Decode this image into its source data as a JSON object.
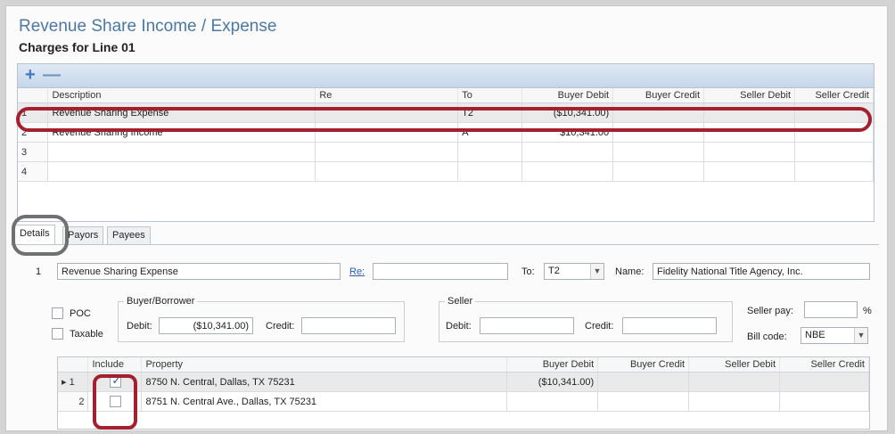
{
  "header": {
    "title": "Revenue Share Income / Expense",
    "subtitle": "Charges for Line 01"
  },
  "toolbar": {
    "add_label": "+",
    "remove_label": "—"
  },
  "charges": {
    "columns": [
      "",
      "Description",
      "Re",
      "To",
      "Buyer Debit",
      "Buyer Credit",
      "Seller Debit",
      "Seller Credit"
    ],
    "rows": [
      {
        "num": "1",
        "description": "Revenue Sharing Expense",
        "re": "",
        "to": "T2",
        "buyer_debit": "($10,341.00)",
        "buyer_credit": "",
        "seller_debit": "",
        "seller_credit": ""
      },
      {
        "num": "2",
        "description": "Revenue Sharing Income",
        "re": "",
        "to": "A",
        "buyer_debit": "$10,341.00",
        "buyer_credit": "",
        "seller_debit": "",
        "seller_credit": ""
      },
      {
        "num": "3",
        "description": "",
        "re": "",
        "to": "",
        "buyer_debit": "",
        "buyer_credit": "",
        "seller_debit": "",
        "seller_credit": ""
      },
      {
        "num": "4",
        "description": "",
        "re": "",
        "to": "",
        "buyer_debit": "",
        "buyer_credit": "",
        "seller_debit": "",
        "seller_credit": ""
      }
    ]
  },
  "tabs": [
    "Details",
    "Payors",
    "Payees"
  ],
  "details": {
    "line_num": "1",
    "description": "Revenue Sharing Expense",
    "re_label": "Re:",
    "re_value": "",
    "to_label": "To:",
    "to_value": "T2",
    "name_label": "Name:",
    "name_value": "Fidelity National Title Agency, Inc.",
    "poc_label": "POC",
    "taxable_label": "Taxable",
    "buyer_group": "Buyer/Borrower",
    "seller_group": "Seller",
    "debit_label": "Debit:",
    "credit_label": "Credit:",
    "buyer_debit": "($10,341.00)",
    "buyer_credit": "",
    "seller_debit": "",
    "seller_credit": "",
    "seller_pay_label": "Seller pay:",
    "seller_pay_value": "",
    "percent": "%",
    "bill_code_label": "Bill code:",
    "bill_code_value": "NBE"
  },
  "properties": {
    "columns": [
      "",
      "Include",
      "Property",
      "Buyer Debit",
      "Buyer Credit",
      "Seller Debit",
      "Seller Credit"
    ],
    "rows": [
      {
        "marker": "▸",
        "num": "1",
        "include": true,
        "property": "8750 N. Central, Dallas, TX 75231",
        "buyer_debit": "($10,341.00)",
        "buyer_credit": "",
        "seller_debit": "",
        "seller_credit": ""
      },
      {
        "marker": "",
        "num": "2",
        "include": false,
        "property": "8751 N. Central Ave., Dallas, TX 75231",
        "buyer_debit": "",
        "buyer_credit": "",
        "seller_debit": "",
        "seller_credit": ""
      }
    ]
  },
  "colors": {
    "title": "#4a78a8",
    "highlight_ring": "#a3212e",
    "tab_ring": "#707070"
  }
}
